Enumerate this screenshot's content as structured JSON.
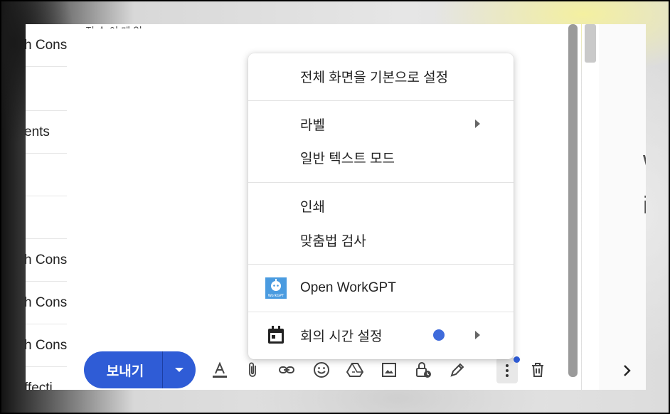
{
  "list_rows": [
    {
      "text": "h Cons"
    },
    {
      "text": ""
    },
    {
      "text": "ents"
    },
    {
      "text": ""
    },
    {
      "text": ""
    },
    {
      "text": "h Cons"
    },
    {
      "text": "h Cons"
    },
    {
      "text": "h Cons"
    },
    {
      "text": "ffecti"
    }
  ],
  "compose": {
    "top_text": "전 송 이 메 일"
  },
  "menu": {
    "items": {
      "fullscreen": "전체 화면을 기본으로 설정",
      "label": "라벨",
      "plain_text": "일반 텍스트 모드",
      "print": "인쇄",
      "spellcheck": "맞춤법 검사",
      "workgpt": "Open WorkGPT",
      "meeting_time": "회의 시간 설정"
    },
    "workgpt_icon_text": "WorkGPT"
  },
  "toolbar": {
    "send_label": "보내기",
    "icons": [
      "format-text-icon",
      "attach-icon",
      "link-icon",
      "emoji-icon",
      "drive-icon",
      "photo-icon",
      "lock-clock-icon",
      "signature-icon",
      "more-options-icon",
      "delete-icon"
    ]
  },
  "right_strip": {
    "big": "V",
    "line1": "w.",
    "line2": "ia"
  },
  "colors": {
    "send_button": "#2f5cd6",
    "notify_dot": "#3f6bdb"
  }
}
